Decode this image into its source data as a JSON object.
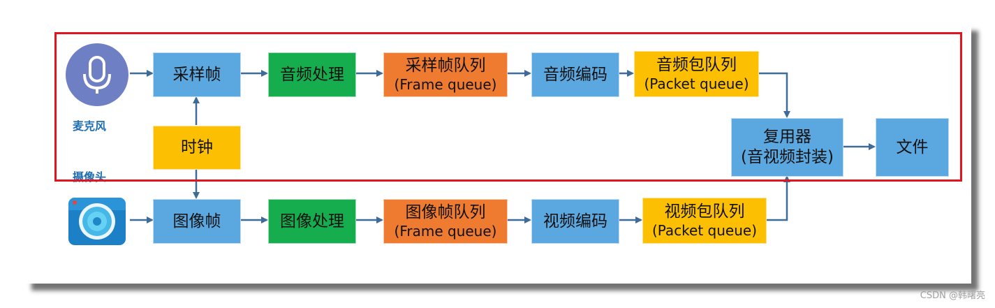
{
  "colors": {
    "blue_box": "#5ba7e0",
    "green_box": "#16ad4e",
    "orange_box": "#ee7b30",
    "yellow_box": "#fcbf02",
    "arrow": "#3f6b99",
    "highlight_frame": "#e0151f",
    "label_text": "#1f6fb2"
  },
  "labels": {
    "microphone": "麦克风",
    "camera": "摄像头"
  },
  "audio_row": {
    "sample_frame": "采样帧",
    "audio_processing": "音频处理",
    "sample_queue_line1": "采样帧队列",
    "sample_queue_line2": "(Frame queue)",
    "audio_encoding": "音频编码",
    "audio_packet_queue_line1": "音频包队列",
    "audio_packet_queue_line2": "(Packet queue)"
  },
  "clock": "时钟",
  "video_row": {
    "image_frame": "图像帧",
    "image_processing": "图像处理",
    "image_queue_line1": "图像帧队列",
    "image_queue_line2": "(Frame queue)",
    "video_encoding": "视频编码",
    "video_packet_queue_line1": "视频包队列",
    "video_packet_queue_line2": "(Packet queue)"
  },
  "muxer_line1": "复用器",
  "muxer_line2": "(音视频封装)",
  "file": "文件",
  "watermark": "CSDN @韩曙亮",
  "icons": [
    "microphone-icon",
    "camera-icon"
  ]
}
